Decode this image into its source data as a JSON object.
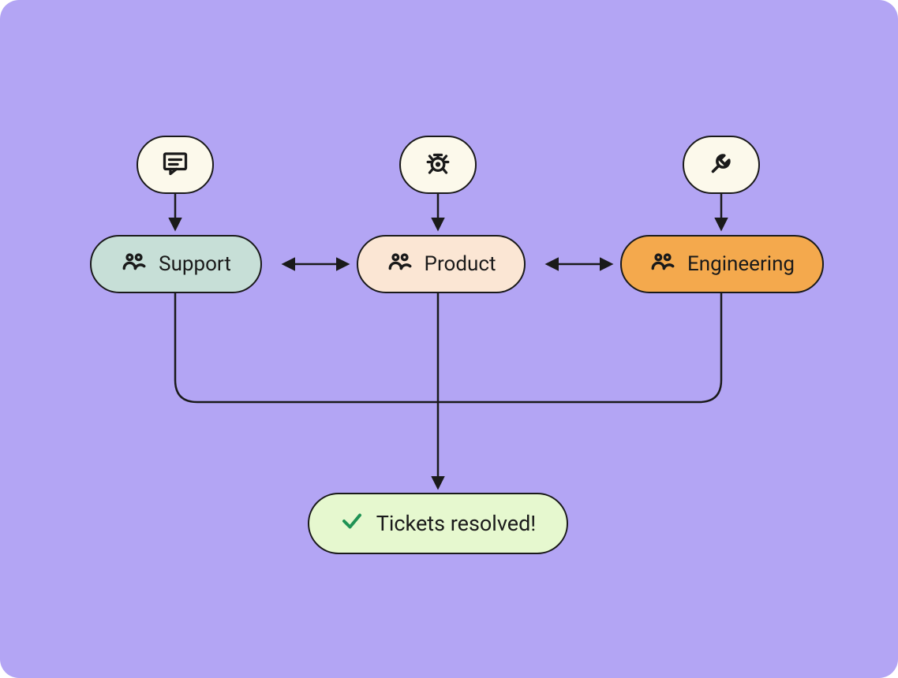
{
  "colors": {
    "background": "#B3A5F4",
    "badge_bg": "#FCF9EB",
    "support_bg": "#C7DFD7",
    "product_bg": "#FBE6D4",
    "engineering_bg": "#F4A94D",
    "result_bg": "#E6F8CF",
    "stroke": "#1A1A1A",
    "check": "#1F9254"
  },
  "badges": {
    "support_icon": "chat-icon",
    "product_icon": "bug-icon",
    "engineering_icon": "wrench-icon"
  },
  "teams": {
    "support": "Support",
    "product": "Product",
    "engineering": "Engineering"
  },
  "result": {
    "label": "Tickets resolved!"
  },
  "diagram": {
    "flow": [
      "chat-icon -> Support",
      "bug-icon -> Product",
      "wrench-icon -> Engineering",
      "Support <-> Product",
      "Product <-> Engineering",
      "Support -> Tickets resolved!",
      "Product -> Tickets resolved!",
      "Engineering -> Tickets resolved!"
    ]
  }
}
